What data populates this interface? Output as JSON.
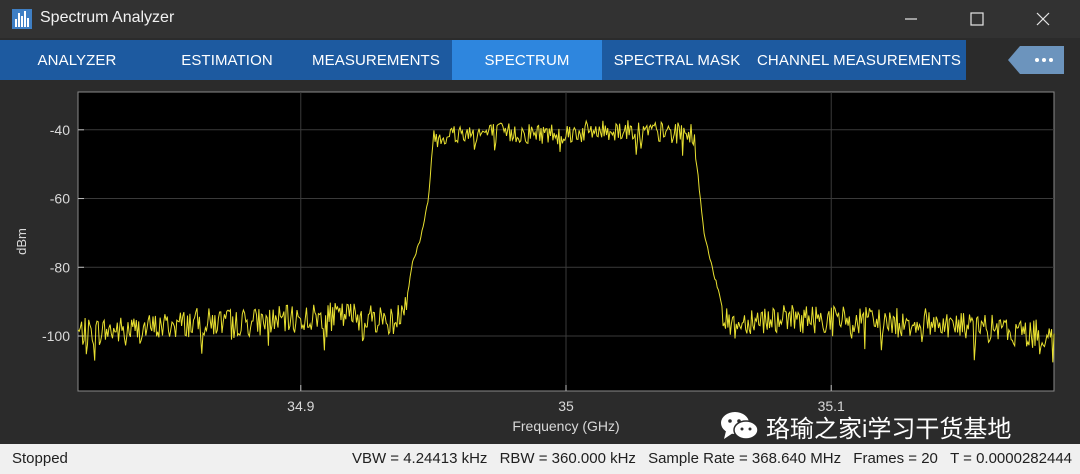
{
  "window": {
    "title": "Spectrum Analyzer",
    "accent": "#1d5aa0",
    "active_tab_color": "#2e86de",
    "trace_color": "#e8e030"
  },
  "ribbon": {
    "tabs": [
      {
        "label": "ANALYZER",
        "active": false
      },
      {
        "label": "ESTIMATION",
        "active": false
      },
      {
        "label": "MEASUREMENTS",
        "active": false
      },
      {
        "label": "SPECTRUM",
        "active": true
      },
      {
        "label": "SPECTRAL MASK",
        "active": false
      },
      {
        "label": "CHANNEL MEASUREMENTS",
        "active": false
      }
    ],
    "more_icon": "ellipsis-icon"
  },
  "chart_data": {
    "type": "line",
    "title": "",
    "xlabel": "Frequency (GHz)",
    "ylabel": "dBm",
    "xlim": [
      34.816,
      35.184
    ],
    "ylim": [
      -116,
      -29
    ],
    "xticks": [
      34.9,
      35.0,
      35.1
    ],
    "xtick_labels": [
      "34.9",
      "35",
      "35.1"
    ],
    "yticks": [
      -40,
      -60,
      -80,
      -100
    ],
    "ytick_labels": [
      "-40",
      "-60",
      "-80",
      "-100"
    ],
    "grid": true,
    "series": [
      {
        "color": "#e8e030",
        "x": [
          34.816,
          34.84,
          34.86,
          34.88,
          34.9,
          34.92,
          34.93,
          34.936,
          34.94,
          34.942,
          34.945,
          34.948,
          34.95,
          34.96,
          34.98,
          35.0,
          35.02,
          35.04,
          35.048,
          35.05,
          35.052,
          35.055,
          35.058,
          35.06,
          35.064,
          35.07,
          35.08,
          35.1,
          35.12,
          35.14,
          35.16,
          35.184
        ],
        "y": [
          -99,
          -98,
          -96,
          -96,
          -95,
          -94,
          -95,
          -96,
          -88,
          -79,
          -72,
          -61,
          -42,
          -41,
          -41,
          -41,
          -40,
          -41,
          -41,
          -55,
          -70,
          -80,
          -88,
          -96,
          -97,
          -95,
          -95,
          -95,
          -96,
          -96,
          -98,
          -100
        ]
      }
    ]
  },
  "status": {
    "state": "Stopped",
    "vbw": "VBW = 4.24413 kHz",
    "rbw": "RBW = 360.000 kHz",
    "sample_rate": "Sample Rate = 368.640 MHz",
    "frames": "Frames = 20",
    "time": "T = 0.0000282444"
  },
  "watermark": {
    "text": "珞瑜之家i学习干货基地",
    "icon": "wechat-icon"
  }
}
